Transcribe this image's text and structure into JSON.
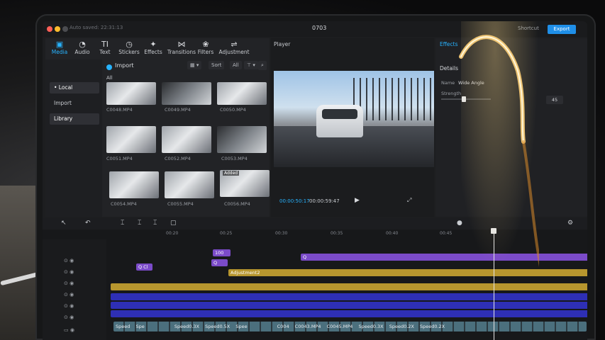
{
  "window": {
    "autosave": "Auto saved: 22:31:13",
    "title": "0703",
    "shortcut": "Shortcut",
    "export": "Export"
  },
  "media_toolbar": [
    {
      "label": "Media",
      "icon": "media-icon",
      "glyph": "▣"
    },
    {
      "label": "Audio",
      "icon": "audio-icon",
      "glyph": "◔"
    },
    {
      "label": "Text",
      "icon": "text-icon",
      "glyph": "TI"
    },
    {
      "label": "Stickers",
      "icon": "stickers-icon",
      "glyph": "◷"
    },
    {
      "label": "Effects",
      "icon": "effects-icon",
      "glyph": "✦"
    },
    {
      "label": "Transitions",
      "icon": "transitions-icon",
      "glyph": "⋈"
    },
    {
      "label": "Filters",
      "icon": "filters-icon",
      "glyph": "❀"
    },
    {
      "label": "Adjustment",
      "icon": "adjustment-icon",
      "glyph": "⇌"
    }
  ],
  "side_nav": [
    "• Local",
    "Import",
    "Library"
  ],
  "media": {
    "import_label": "Import",
    "sort_label": "Sort",
    "all_label": "All",
    "filter_label": "All",
    "section_label": "All",
    "clips": [
      {
        "name": "C0048.MP4"
      },
      {
        "name": "C0049.MP4"
      },
      {
        "name": "C0050.MP4"
      },
      {
        "name": "C0051.MP4"
      },
      {
        "name": "C0052.MP4"
      },
      {
        "name": "C0053.MP4"
      },
      {
        "name": "C0054.MP4"
      },
      {
        "name": "C0055.MP4"
      },
      {
        "name": "C0056.MP4",
        "badge": "Added"
      }
    ]
  },
  "player": {
    "title": "Player",
    "current_time": "00:00:50:17",
    "duration": "00:00:59:47"
  },
  "effects_panel": {
    "tab": "Effects",
    "details": "Details",
    "name_label": "Name",
    "name_value": "Wide Angle",
    "strength_label": "Strength",
    "strength_value": "45",
    "strength_fraction": 0.45
  },
  "timeline": {
    "ticks": [
      "00:20",
      "00:25",
      "00:30",
      "00:35",
      "00:40",
      "00:45"
    ],
    "clips": {
      "top_label": "100",
      "adjustment_label": "Adjustment2",
      "q_label": "Q",
      "qc_label": "Q Cl",
      "film_labels": [
        "Speed",
        "Spe",
        "Speed0.3X",
        "Speed0.5X",
        "Spee",
        "C004",
        "C0043.MP4",
        "C0045.MP4",
        "Speed0.3X",
        "Speed0.2X",
        "Speed0.2X"
      ]
    }
  }
}
